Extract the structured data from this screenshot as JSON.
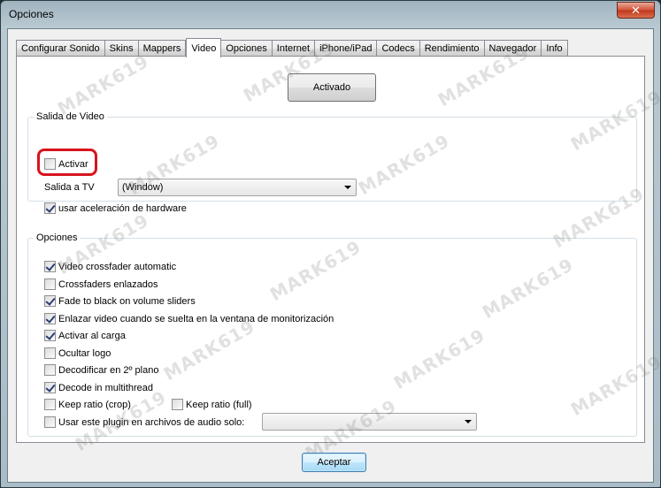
{
  "window": {
    "title": "Opciones",
    "close_glyph": "✕"
  },
  "tabs": [
    {
      "label": "Configurar Sonido"
    },
    {
      "label": "Skins"
    },
    {
      "label": "Mappers"
    },
    {
      "label": "Video",
      "active": true
    },
    {
      "label": "Opciones"
    },
    {
      "label": "Internet"
    },
    {
      "label": "iPhone/iPad"
    },
    {
      "label": "Codecs"
    },
    {
      "label": "Rendimiento"
    },
    {
      "label": "Navegador"
    },
    {
      "label": "Info"
    }
  ],
  "video_page": {
    "activado_button": "Activado",
    "salida_group": {
      "title": "Salida de Video",
      "activar": {
        "label": "Activar",
        "checked": false
      },
      "salida_tv_label": "Salida a TV",
      "salida_tv_value": "(Window)",
      "hw_accel": {
        "label": "usar aceleración de hardware",
        "checked": true
      }
    },
    "opciones_group": {
      "title": "Opciones",
      "items": [
        {
          "label": "Video crossfader automatic",
          "checked": true
        },
        {
          "label": "Crossfaders enlazados",
          "checked": false
        },
        {
          "label": "Fade to black on volume sliders",
          "checked": true
        },
        {
          "label": "Enlazar video cuando se suelta en la ventana de monitorización",
          "checked": true
        },
        {
          "label": "Activar al carga",
          "checked": true
        },
        {
          "label": "Ocultar logo",
          "checked": false
        },
        {
          "label": "Decodificar en 2º plano",
          "checked": false
        },
        {
          "label": "Decode in multithread",
          "checked": true
        }
      ],
      "keep_ratio_crop": {
        "label": "Keep ratio (crop)",
        "checked": false
      },
      "keep_ratio_full": {
        "label": "Keep ratio (full)",
        "checked": false
      },
      "audio_plugin": {
        "label": "Usar este plugin en archivos de audio solo:",
        "checked": false,
        "value": ""
      }
    }
  },
  "footer": {
    "accept_button": "Aceptar"
  },
  "watermark": "MARK619",
  "colors": {
    "highlight": "#d7141e",
    "close_button": "#c23a1e"
  }
}
